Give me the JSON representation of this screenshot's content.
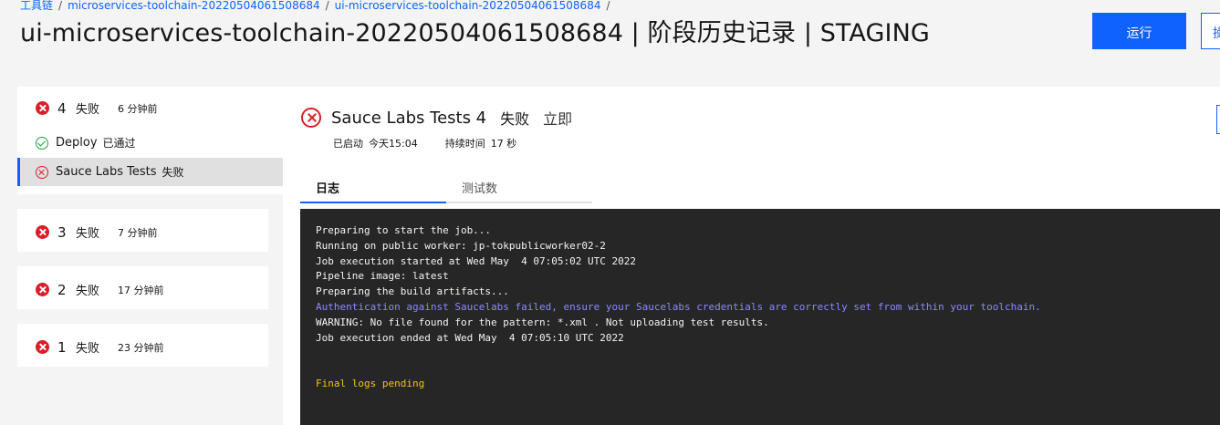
{
  "breadcrumb": [
    "工具链",
    "microservices-toolchain-20220504061508684",
    "ui-microservices-toolchain-20220504061508684"
  ],
  "breadcrumb_sep": "/",
  "page_title": "ui-microservices-toolchain-20220504061508684 | 阶段历史记录 | STAGING",
  "run_button": "运行",
  "second_button": "操",
  "runs": [
    {
      "num": "4",
      "status": "失败",
      "time": "6 分钟前"
    },
    {
      "num": "3",
      "status": "失败",
      "time": "7 分钟前"
    },
    {
      "num": "2",
      "status": "失败",
      "time": "17 分钟前"
    },
    {
      "num": "1",
      "status": "失败",
      "time": "23 分钟前"
    }
  ],
  "stages": [
    {
      "name": "Deploy",
      "status": "已通过",
      "icon": "check-circle-icon"
    },
    {
      "name": "Sauce Labs Tests",
      "status": "失败",
      "icon": "error-outline-icon"
    }
  ],
  "detail": {
    "title": "Sauce Labs Tests 4",
    "status": "失败",
    "time": "立即",
    "started_label": "已启动",
    "started_value": "今天15:04",
    "duration_label": "持续时间",
    "duration_value": "17 秒"
  },
  "tabs": [
    "日志",
    "测试数"
  ],
  "log": [
    "Preparing to start the job...",
    "Running on public worker: jp-tokpublicworker02-2",
    "Job execution started at Wed May  4 07:05:02 UTC 2022",
    "Pipeline image: latest",
    "Preparing the build artifacts...",
    "Authentication against Saucelabs failed, ensure your Saucelabs credentials are correctly set from within your toolchain.",
    "WARNING: No file found for the pattern: *.xml . Not uploading test results.",
    "Job execution ended at Wed May  4 07:05:10 UTC 2022",
    "Final logs pending"
  ],
  "colors": {
    "accent": "#0f62fe",
    "error": "#da1e28",
    "success": "#24a148",
    "log_bg": "#262626",
    "log_link": "#8a8aff",
    "log_pending": "#f1c21b"
  }
}
